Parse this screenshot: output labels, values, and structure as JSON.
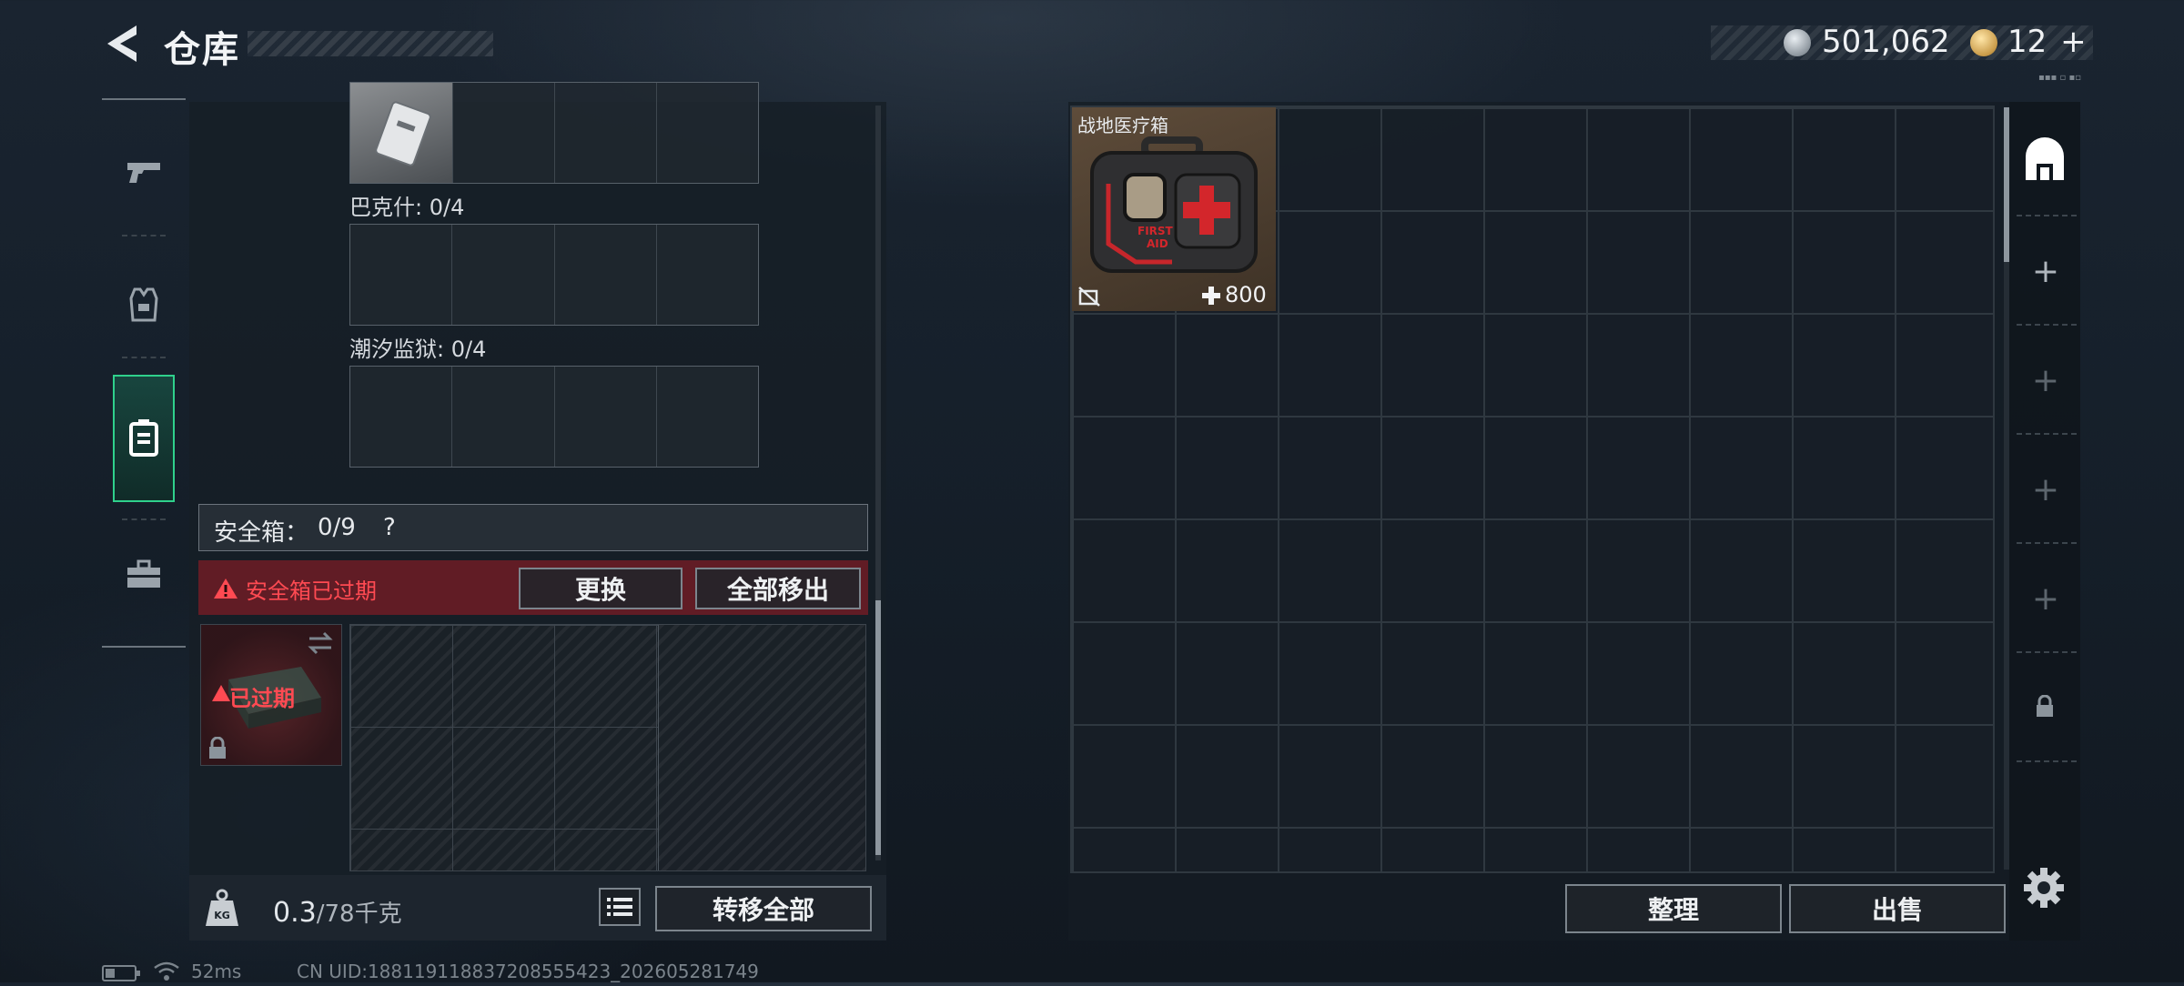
{
  "header": {
    "title": "仓库",
    "silver_amount": "501,062",
    "gold_amount": "12",
    "gold_plus": "+",
    "tiny_text": "▪▪▪ ▫ ▪▫"
  },
  "nav": {
    "items": [
      "weapons",
      "armor",
      "backpack",
      "toolbox"
    ],
    "active": "backpack"
  },
  "left_panel": {
    "slot_groups": [
      {
        "label": "巴克什: 0/4"
      },
      {
        "label": "潮汐监狱: 0/4"
      }
    ],
    "safe_box": {
      "title": "安全箱：",
      "count": "0/9",
      "help": "?",
      "expired_warning": "安全箱已过期",
      "replace_label": "更换",
      "move_all_out_label": "全部移出",
      "case_status": "已过期"
    },
    "footer": {
      "weight_current": "0.3",
      "weight_max": "/78千克",
      "transfer_all_label": "转移全部"
    }
  },
  "stash": {
    "item": {
      "name": "战地医疗箱",
      "count": "800"
    },
    "sort_label": "整理",
    "sell_label": "出售"
  },
  "status_bar": {
    "ping": "52ms",
    "uid": "CN UID:188119118837208555423_202605281749"
  },
  "colors": {
    "accent_green": "#2fd18c",
    "warning_red": "#ff4a52",
    "expired_bg": "#a01c24"
  }
}
